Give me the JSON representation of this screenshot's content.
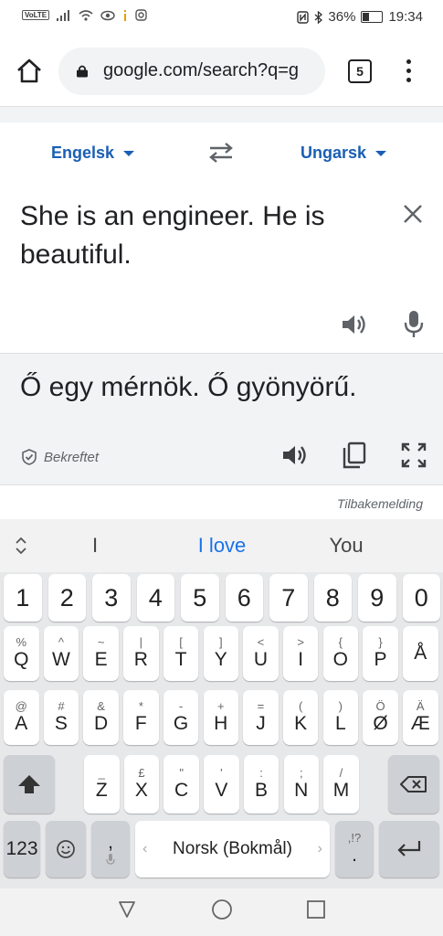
{
  "status_bar": {
    "volte": "VoLTE",
    "battery": "36%",
    "time": "19:34"
  },
  "browser": {
    "url": "google.com/search?q=g",
    "tab_count": "5"
  },
  "translator": {
    "source_language": "Engelsk",
    "target_language": "Ungarsk",
    "source_text": "She is an engineer. He is beautiful.",
    "translated_text": "Ő egy mérnök. Ő gyönyörű.",
    "verified_label": "Bekreftet",
    "feedback_label": "Tilbakemelding"
  },
  "keyboard": {
    "suggestions": [
      "I",
      "I love",
      "You"
    ],
    "number_row": [
      "1",
      "2",
      "3",
      "4",
      "5",
      "6",
      "7",
      "8",
      "9",
      "0"
    ],
    "row1": [
      {
        "sup": "%",
        "main": "Q"
      },
      {
        "sup": "^",
        "main": "W"
      },
      {
        "sup": "~",
        "main": "E"
      },
      {
        "sup": "|",
        "main": "R"
      },
      {
        "sup": "[",
        "main": "T"
      },
      {
        "sup": "]",
        "main": "Y"
      },
      {
        "sup": "<",
        "main": "U"
      },
      {
        "sup": ">",
        "main": "I"
      },
      {
        "sup": "{",
        "main": "O"
      },
      {
        "sup": "}",
        "main": "P"
      },
      {
        "sup": "",
        "main": "Å"
      }
    ],
    "row2": [
      {
        "sup": "@",
        "main": "A"
      },
      {
        "sup": "#",
        "main": "S"
      },
      {
        "sup": "&",
        "main": "D"
      },
      {
        "sup": "*",
        "main": "F"
      },
      {
        "sup": "-",
        "main": "G"
      },
      {
        "sup": "+",
        "main": "H"
      },
      {
        "sup": "=",
        "main": "J"
      },
      {
        "sup": "(",
        "main": "K"
      },
      {
        "sup": ")",
        "main": "L"
      },
      {
        "sup": "Ö",
        "main": "Ø"
      },
      {
        "sup": "Ä",
        "main": "Æ"
      }
    ],
    "row3": [
      {
        "sup": "_",
        "main": "Z"
      },
      {
        "sup": "£",
        "main": "X"
      },
      {
        "sup": "\"",
        "main": "C"
      },
      {
        "sup": "'",
        "main": "V"
      },
      {
        "sup": ":",
        "main": "B"
      },
      {
        "sup": ";",
        "main": "N"
      },
      {
        "sup": "/",
        "main": "M"
      }
    ],
    "symbols_key": "123",
    "comma_key": ",",
    "space_label": "Norsk (Bokmål)",
    "period_key": ".",
    "period_sup": ",!?"
  },
  "colors": {
    "accent": "#1a5fb4",
    "suggestion_highlight": "#1a73e8",
    "result_background": "#f1f3f4",
    "keyboard_background": "#e7e8ea"
  },
  "icons": {
    "home": "home-icon",
    "lock": "lock-icon",
    "menu": "more-vert-icon",
    "swap": "swap-arrows-icon",
    "clear": "close-icon",
    "speaker": "speaker-icon",
    "mic": "mic-icon",
    "copy": "copy-icon",
    "expand": "fullscreen-icon",
    "verified": "shield-check-icon"
  }
}
